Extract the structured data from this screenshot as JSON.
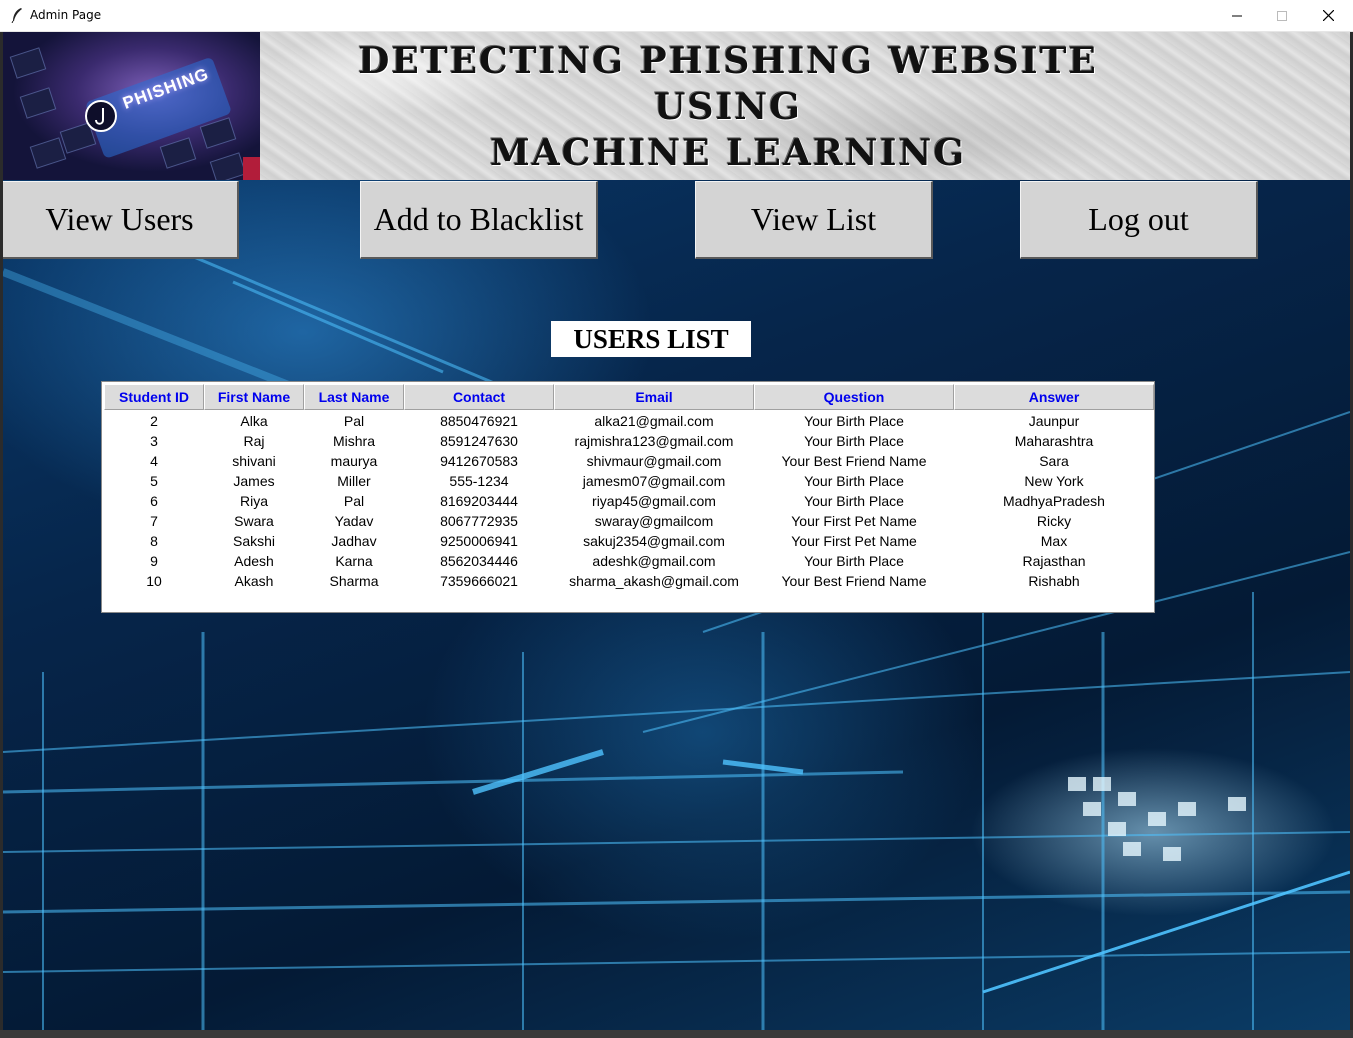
{
  "window": {
    "title": "Admin Page",
    "minimize_glyph": "—",
    "maximize_glyph": "☐",
    "close_glyph": "✕"
  },
  "banner": {
    "logo_text": "PHISHING",
    "title_lines": [
      "DETECTING PHISHING WEBSITE",
      "USING",
      "MACHINE LEARNING"
    ]
  },
  "nav": {
    "view_users": "View Users",
    "add_to_blacklist": "Add to Blacklist",
    "view_list": "View List",
    "log_out": "Log out"
  },
  "users_list": {
    "heading": "USERS LIST",
    "columns": [
      "Student ID",
      "First Name",
      "Last Name",
      "Contact",
      "Email",
      "Question",
      "Answer"
    ],
    "rows": [
      [
        "2",
        "Alka",
        "Pal",
        "8850476921",
        "alka21@gmail.com",
        "Your Birth Place",
        "Jaunpur"
      ],
      [
        "3",
        "Raj",
        "Mishra",
        "8591247630",
        "rajmishra123@gmail.com",
        "Your Birth Place",
        "Maharashtra"
      ],
      [
        "4",
        "shivani",
        "maurya",
        "9412670583",
        "shivmaur@gmail.com",
        "Your Best Friend Name",
        "Sara"
      ],
      [
        "5",
        "James",
        "Miller",
        "555-1234",
        "jamesm07@gmail.com",
        "Your Birth Place",
        "New York"
      ],
      [
        "6",
        "Riya",
        "Pal",
        "8169203444",
        "riyap45@gmail.com",
        "Your Birth Place",
        "MadhyaPradesh"
      ],
      [
        "7",
        "Swara",
        "Yadav",
        "8067772935",
        "swaray@gmailcom",
        "Your First Pet Name",
        "Ricky"
      ],
      [
        "8",
        "Sakshi",
        "Jadhav",
        "9250006941",
        "sakuj2354@gmail.com",
        "Your First Pet Name",
        "Max"
      ],
      [
        "9",
        "Adesh",
        "Karna",
        "8562034446",
        "adeshk@gmail.com",
        "Your Birth Place",
        "Rajasthan"
      ],
      [
        "10",
        "Akash",
        "Sharma",
        "7359666021",
        "sharma_akash@gmail.com",
        "Your Best Friend Name",
        "Rishabh"
      ]
    ]
  }
}
